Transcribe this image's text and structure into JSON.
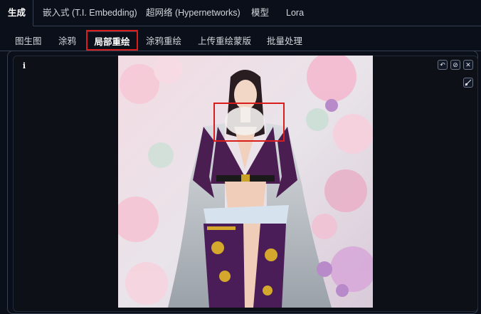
{
  "top_tabs": [
    {
      "label": "生成"
    },
    {
      "label": "嵌入式 (T.I. Embedding)"
    },
    {
      "label": "超网络 (Hypernetworks)"
    },
    {
      "label": "模型"
    },
    {
      "label": "Lora"
    }
  ],
  "sub_tabs": [
    {
      "label": "图生图"
    },
    {
      "label": "涂鸦"
    },
    {
      "label": "局部重绘"
    },
    {
      "label": "涂鸦重绘"
    },
    {
      "label": "上传重绘蒙版"
    },
    {
      "label": "批量处理"
    }
  ],
  "editor": {
    "info_label": "i",
    "controls": [
      {
        "icon": "undo-icon",
        "glyph": "↶"
      },
      {
        "icon": "clear-icon",
        "glyph": "⊘"
      },
      {
        "icon": "close-icon",
        "glyph": "✕"
      }
    ],
    "brush_icon": "brush-icon"
  },
  "colors": {
    "background": "#0b0f19",
    "highlight": "#d91d1d",
    "border": "#374151"
  }
}
